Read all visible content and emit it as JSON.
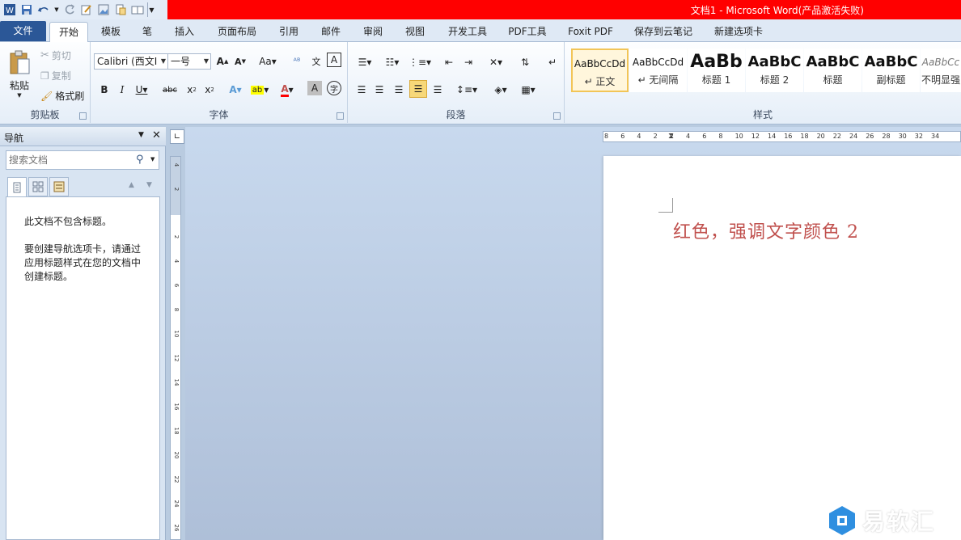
{
  "window": {
    "title": "文档1 - Microsoft Word(产品激活失败)"
  },
  "tabs": {
    "file": "文件",
    "home": "开始",
    "template": "模板",
    "pen": "笔",
    "insert": "插入",
    "layout": "页面布局",
    "references": "引用",
    "mailings": "邮件",
    "review": "审阅",
    "view": "视图",
    "developer": "开发工具",
    "pdf": "PDF工具",
    "foxit": "Foxit PDF",
    "cloud": "保存到云笔记",
    "newtab": "新建选项卡"
  },
  "clipboard": {
    "paste": "粘贴",
    "cut": "剪切",
    "copy": "复制",
    "format_painter": "格式刷",
    "label": "剪贴板"
  },
  "font": {
    "name": "Calibri (西文I",
    "size": "一号",
    "label": "字体"
  },
  "paragraph": {
    "label": "段落"
  },
  "styles": {
    "label": "样式",
    "items": [
      {
        "sample": "AaBbCcDd",
        "name": "↵ 正文"
      },
      {
        "sample": "AaBbCcDd",
        "name": "↵ 无间隔"
      },
      {
        "sample": "AaBb",
        "name": "标题 1"
      },
      {
        "sample": "AaBbC",
        "name": "标题 2"
      },
      {
        "sample": "AaBbC",
        "name": "标题"
      },
      {
        "sample": "AaBbC",
        "name": "副标题"
      },
      {
        "sample": "AaBbCc",
        "name": "不明显强"
      }
    ]
  },
  "nav": {
    "title": "导航",
    "search_placeholder": "搜索文档",
    "message_line1": "此文档不包含标题。",
    "message_line2": "要创建导航选项卡，请通过应用标题样式在您的文档中创建标题。"
  },
  "ruler": {
    "horizontal": [
      "8",
      "6",
      "4",
      "2",
      "2",
      "4",
      "6",
      "8",
      "10",
      "12",
      "14",
      "16",
      "18",
      "20",
      "22",
      "24",
      "26",
      "28",
      "30",
      "32",
      "34"
    ],
    "vertical": [
      "4",
      "2",
      "2",
      "4",
      "6",
      "8",
      "10",
      "12",
      "14",
      "16",
      "18",
      "20",
      "22",
      "24",
      "26"
    ]
  },
  "document": {
    "text": "红色，强调文字颜色 2"
  },
  "watermark": {
    "text": "易软汇"
  },
  "colors": {
    "title_bar": "#ff0000",
    "file_tab": "#2b5797",
    "doc_text": "#c0504d",
    "style_selected": "#f2c557"
  }
}
